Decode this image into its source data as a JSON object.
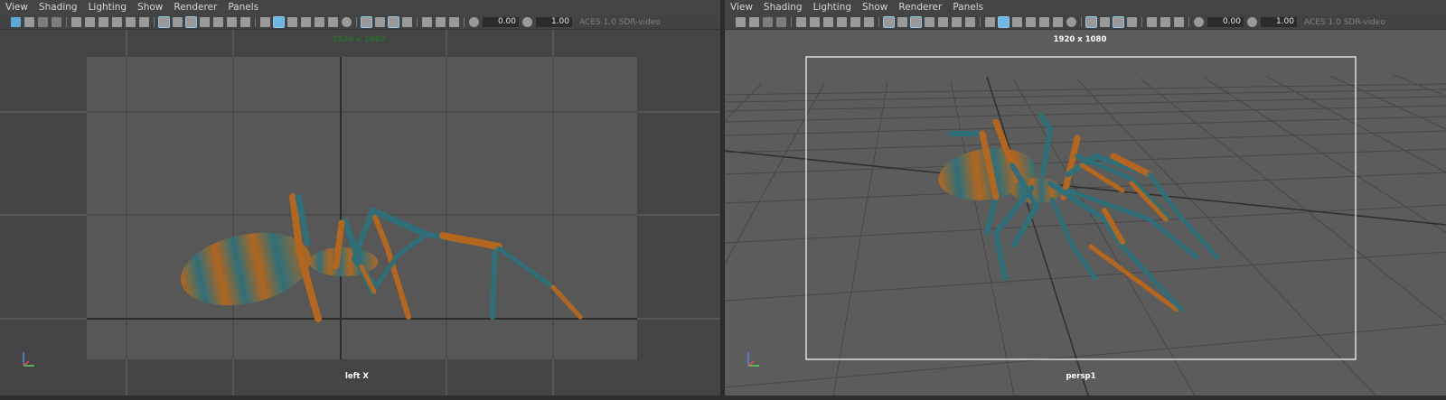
{
  "left_panel": {
    "menus": [
      "View",
      "Shading",
      "Lighting",
      "Show",
      "Renderer",
      "Panels"
    ],
    "exposure_value": "0.00",
    "gamma_value": "1.00",
    "color_space": "ACES 1.0 SDR-video",
    "resolution": "1920 x 1080",
    "camera": "left X"
  },
  "right_panel": {
    "menus": [
      "View",
      "Shading",
      "Lighting",
      "Show",
      "Renderer",
      "Panels"
    ],
    "exposure_value": "0.00",
    "gamma_value": "1.00",
    "color_space": "ACES 1.0 SDR-video",
    "resolution": "1920 x 1080",
    "camera": "persp1"
  },
  "icons": {
    "camera_select": "camera-select-icon",
    "grid": "grid-icon",
    "wireframe": "wireframe-icon",
    "smooth_shade": "smooth-shade-icon",
    "textured": "textured-icon",
    "lighting": "lighting-icon",
    "xray": "xray-icon",
    "isolate": "isolate-select-icon",
    "exposure": "exposure-icon",
    "gamma": "gamma-icon"
  },
  "colors": {
    "left_resolution_text": "#2f6b2f",
    "right_resolution_text": "#ffffff",
    "accent": "#5aa9d6",
    "spider_orange": "#b4661e",
    "spider_teal": "#2f6f7a"
  }
}
